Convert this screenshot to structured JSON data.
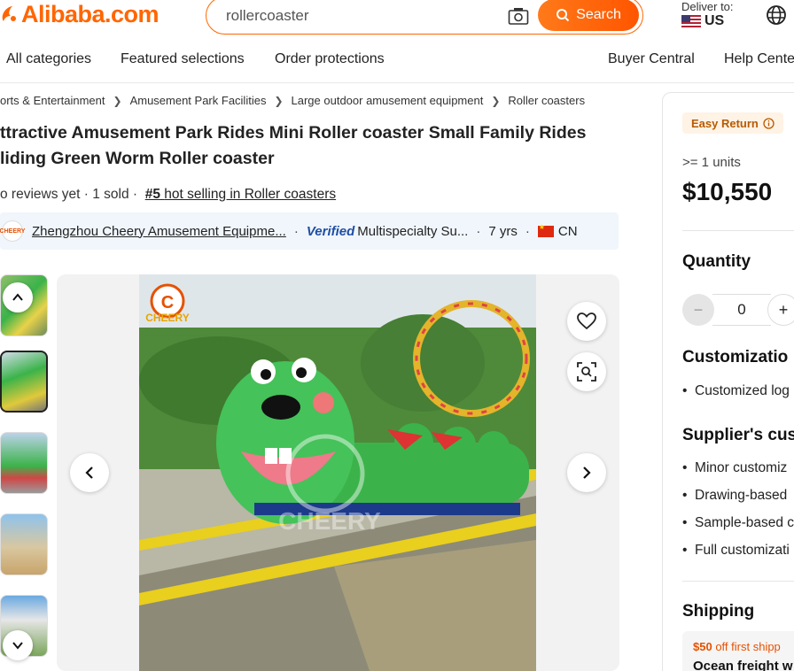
{
  "header": {
    "logo": "Alibaba.com",
    "search_value": "rollercoaster",
    "search_button": "Search",
    "deliver_label": "Deliver to:",
    "deliver_country": "US"
  },
  "nav": {
    "items": [
      "All categories",
      "Featured selections",
      "Order protections"
    ],
    "right_items": [
      "Buyer Central",
      "Help Cente"
    ]
  },
  "breadcrumb": [
    "orts & Entertainment",
    "Amusement Park Facilities",
    "Large outdoor amusement equipment",
    "Roller coasters"
  ],
  "product": {
    "title_line1": "ttractive Amusement Park Rides Mini Roller coaster Small Family Rides",
    "title_line2": "liding Green Worm Roller coaster",
    "reviews": "o reviews yet",
    "sold": "1 sold",
    "rank_num": "#5",
    "rank_text": "hot selling in Roller coasters"
  },
  "supplier": {
    "logo_text": "CHEERY",
    "name": "Zhengzhou Cheery Amusement Equipme...",
    "verified": "Verified",
    "type": "Multispecialty Su...",
    "years": "7 yrs",
    "country": "CN"
  },
  "gallery": {
    "watermark": "CHEERY"
  },
  "panel": {
    "easy_return": "Easy Return",
    "units": ">= 1 units",
    "price": "$10,550",
    "quantity_label": "Quantity",
    "quantity_value": "0",
    "customization_title": "Customizatio",
    "customization_items": [
      "Customized log"
    ],
    "supplier_custom_title": "Supplier's cus",
    "supplier_custom_items": [
      "Minor customiz",
      "Drawing-based",
      "Sample-based c",
      "Full customizati"
    ],
    "shipping_title": "Shipping",
    "promo_amount": "$50",
    "promo_text": "off first shipp",
    "promo_sub": "Ocean freight w"
  },
  "colors": {
    "brand": "#ff6600",
    "verified": "#1f4fa3",
    "worm_green": "#3bb34a"
  }
}
